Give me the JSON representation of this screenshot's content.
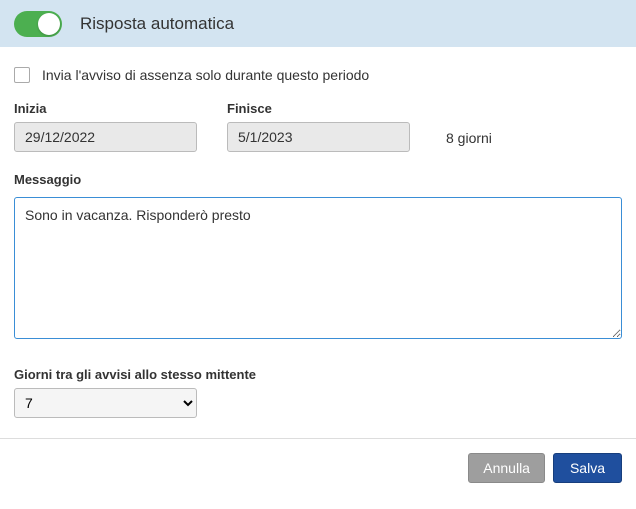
{
  "header": {
    "title": "Risposta automatica",
    "toggle_on": true
  },
  "period_checkbox": {
    "checked": false,
    "label": "Invia l'avviso di assenza solo durante questo periodo"
  },
  "dates": {
    "start_label": "Inizia",
    "start_value": "29/12/2022",
    "end_label": "Finisce",
    "end_value": "5/1/2023",
    "duration_text": "8 giorni"
  },
  "message": {
    "label": "Messaggio",
    "value": "Sono in vacanza. Risponderò presto"
  },
  "days_between": {
    "label": "Giorni tra gli avvisi allo stesso mittente",
    "value": "7"
  },
  "buttons": {
    "cancel": "Annulla",
    "save": "Salva"
  }
}
